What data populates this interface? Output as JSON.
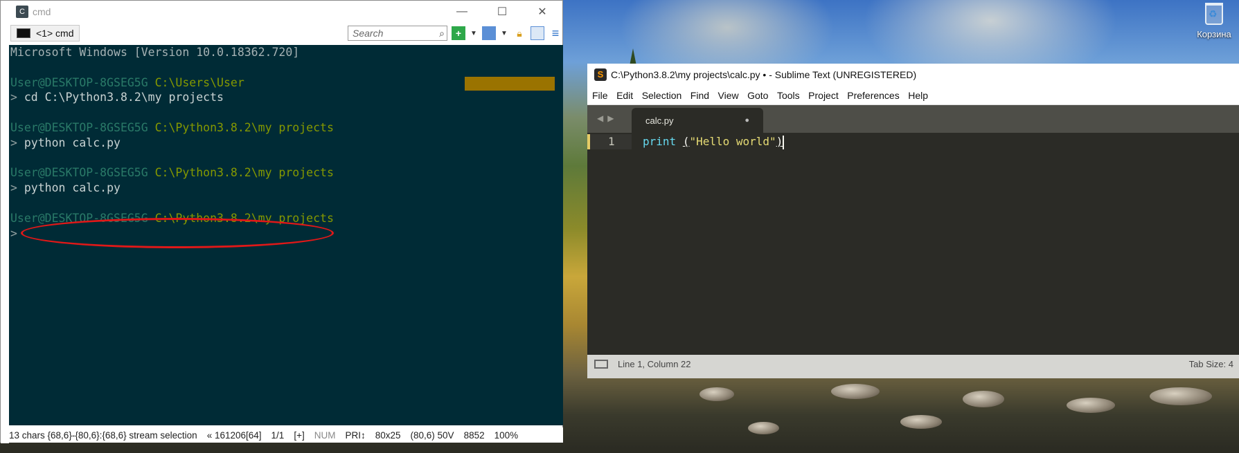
{
  "desktop": {
    "recycle_bin_label": "Корзина"
  },
  "cmd_window": {
    "title": "cmd",
    "tab_label": "<1> cmd",
    "search_placeholder": "Search",
    "console_lines": [
      {
        "segments": [
          {
            "text": "Microsoft Windows [Version 10.0.18362.720]",
            "cls": "c-grey"
          }
        ]
      },
      {
        "segments": []
      },
      {
        "segments": [
          {
            "text": "User@DESKTOP-8GSEG5G ",
            "cls": "c-user"
          },
          {
            "text": "C:\\Users\\User",
            "cls": "c-path"
          }
        ]
      },
      {
        "segments": [
          {
            "text": "> ",
            "cls": "c-prompt"
          },
          {
            "text": "cd C:\\Python3.8.2\\my projects",
            "cls": "c-text"
          }
        ]
      },
      {
        "segments": []
      },
      {
        "segments": [
          {
            "text": "User@DESKTOP-8GSEG5G ",
            "cls": "c-user"
          },
          {
            "text": "C:\\Python3.8.2\\my projects",
            "cls": "c-path"
          }
        ]
      },
      {
        "segments": [
          {
            "text": "> ",
            "cls": "c-prompt"
          },
          {
            "text": "python calc.py",
            "cls": "c-text"
          }
        ]
      },
      {
        "segments": []
      },
      {
        "segments": [
          {
            "text": "User@DESKTOP-8GSEG5G ",
            "cls": "c-user"
          },
          {
            "text": "C:\\Python3.8.2\\my projects",
            "cls": "c-path"
          }
        ]
      },
      {
        "segments": [
          {
            "text": "> ",
            "cls": "c-prompt"
          },
          {
            "text": "python calc.py",
            "cls": "c-text"
          }
        ]
      },
      {
        "segments": []
      },
      {
        "segments": [
          {
            "text": "User@DESKTOP-8GSEG5G ",
            "cls": "c-user"
          },
          {
            "text": "C:\\Python3.8.2\\my projects",
            "cls": "c-path"
          }
        ]
      },
      {
        "segments": [
          {
            "text": ">",
            "cls": "c-prompt"
          }
        ]
      }
    ],
    "status": {
      "selection": "13 chars {68,6}-{80,6}:{68,6} stream selection",
      "pid": "« 161206[64]",
      "pages": "1/1",
      "insert": "[+]",
      "num": "NUM",
      "pri": "PRI↕",
      "size": "80x25",
      "cursor": "(80,6) 50V",
      "pid2": "8852",
      "zoom": "100%"
    }
  },
  "sublime_window": {
    "title": "C:\\Python3.8.2\\my projects\\calc.py • - Sublime Text (UNREGISTERED)",
    "menu": [
      "File",
      "Edit",
      "Selection",
      "Find",
      "View",
      "Goto",
      "Tools",
      "Project",
      "Preferences",
      "Help"
    ],
    "tab_name": "calc.py",
    "line_number": "1",
    "code": {
      "fn": "print",
      "space": " ",
      "open": "(",
      "str": "\"Hello world\"",
      "close": ")"
    },
    "status_left": "Line 1, Column 22",
    "status_right": "Tab Size: 4"
  }
}
